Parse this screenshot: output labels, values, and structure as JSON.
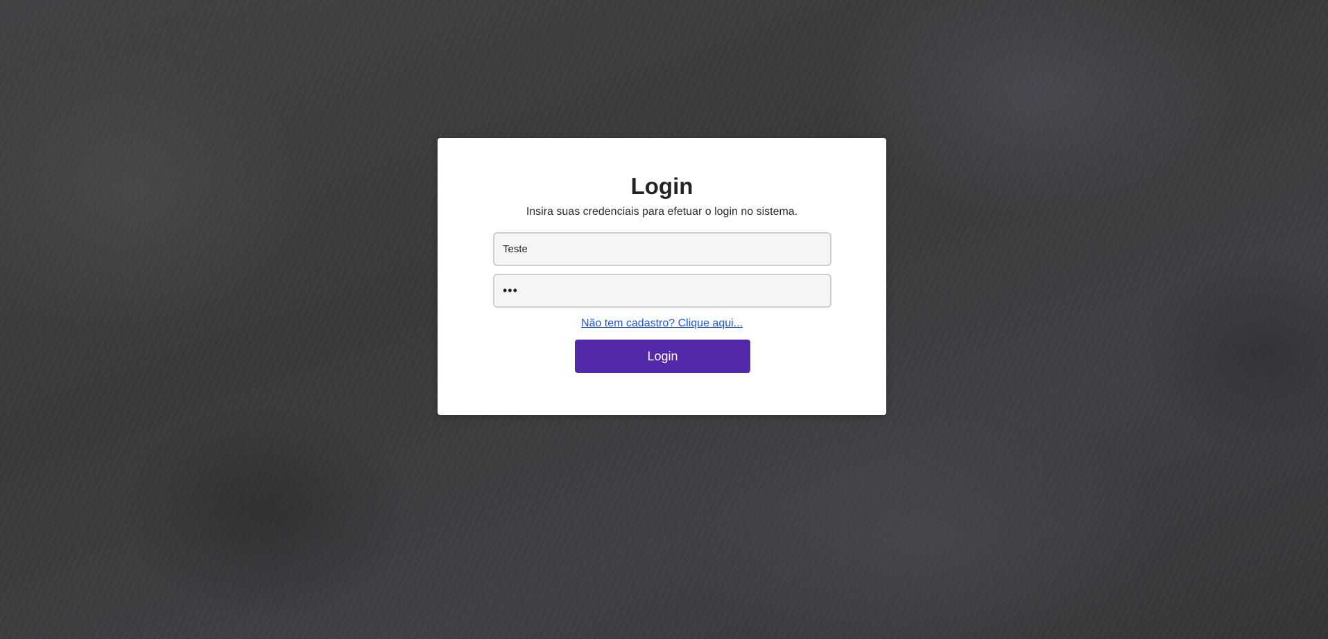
{
  "login": {
    "title": "Login",
    "subtitle": "Insira suas credenciais para efetuar o login no sistema.",
    "username": {
      "value": "Teste"
    },
    "password": {
      "value": "123"
    },
    "register_link": "Não tem cadastro? Clique aqui...",
    "submit_label": "Login"
  },
  "colors": {
    "accent": "#5229a8",
    "link": "#1a56e8",
    "card_background": "#ffffff",
    "page_background": "#3a3839"
  }
}
